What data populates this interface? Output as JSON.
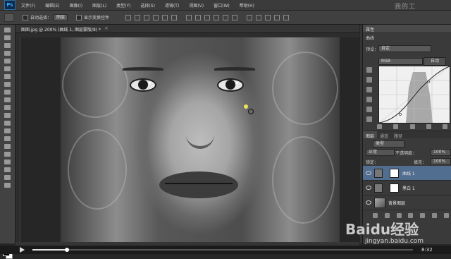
{
  "menubar": {
    "logo": "Ps",
    "items": [
      "文件(F)",
      "编辑(E)",
      "图像(I)",
      "图层(L)",
      "类型(Y)",
      "选择(S)",
      "滤镜(T)",
      "视图(V)",
      "窗口(W)",
      "帮助(H)"
    ],
    "ghost_text": "我的工"
  },
  "options_bar": {
    "auto_select_label": "自动选择：",
    "auto_select_value": "图层",
    "show_transform_label": "显示变换控件"
  },
  "document": {
    "tab_label": "图图.jpg @ 200% (曲线 1, 图层蒙版/8) *",
    "close": "×"
  },
  "properties": {
    "tab": "属性",
    "header": "曲线",
    "preset_label": "预设：",
    "preset_value": "自定",
    "channel_value": "RGB",
    "auto_button": "自动"
  },
  "layers": {
    "tabs": [
      "图层",
      "通道",
      "路径"
    ],
    "kind_value": "类型",
    "blend_mode": "正常",
    "opacity_label": "不透明度：",
    "opacity_value": "100%",
    "lock_label": "锁定：",
    "fill_label": "填充：",
    "fill_value": "100%",
    "rows": [
      {
        "name": "曲线 1",
        "selected": true
      },
      {
        "name": "黑白 1",
        "selected": false
      },
      {
        "name": "背景图层",
        "selected": false
      }
    ]
  },
  "player": {
    "time": "8:32",
    "progress": 0.09
  },
  "watermark": {
    "brand": "Baidu经验",
    "url": "jingyan.baidu.com"
  }
}
